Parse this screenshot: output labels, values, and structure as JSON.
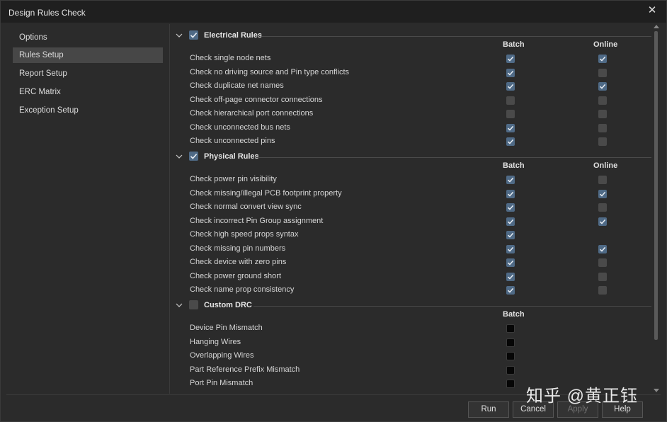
{
  "window": {
    "title": "Design Rules Check"
  },
  "sidebar": {
    "items": [
      {
        "label": "Options"
      },
      {
        "label": "Rules Setup"
      },
      {
        "label": "Report Setup"
      },
      {
        "label": "ERC Matrix"
      },
      {
        "label": "Exception Setup"
      }
    ],
    "active_index": 1
  },
  "sections": [
    {
      "title": "Electrical Rules",
      "enabled": true,
      "headers": {
        "batch": "Batch",
        "online": "Online"
      },
      "rows": [
        {
          "label": "Check single node nets",
          "batch": true,
          "online": true
        },
        {
          "label": "Check no driving source and Pin type conflicts",
          "batch": true,
          "online": false
        },
        {
          "label": "Check duplicate net names",
          "batch": true,
          "online": true
        },
        {
          "label": "Check off-page connector connections",
          "batch": false,
          "online": false
        },
        {
          "label": "Check hierarchical port connections",
          "batch": false,
          "online": false
        },
        {
          "label": "Check unconnected bus nets",
          "batch": true,
          "online": false
        },
        {
          "label": "Check unconnected pins",
          "batch": true,
          "online": false
        }
      ]
    },
    {
      "title": "Physical Rules",
      "enabled": true,
      "headers": {
        "batch": "Batch",
        "online": "Online"
      },
      "rows": [
        {
          "label": "Check power pin visibility",
          "batch": true,
          "online": false
        },
        {
          "label": "Check missing/illegal PCB footprint property",
          "batch": true,
          "online": true
        },
        {
          "label": "Check normal convert view sync",
          "batch": true,
          "online": false
        },
        {
          "label": "Check incorrect Pin Group assignment",
          "batch": true,
          "online": true
        },
        {
          "label": "Check high speed props syntax",
          "batch": true,
          "online": null
        },
        {
          "label": "Check missing pin numbers",
          "batch": true,
          "online": true
        },
        {
          "label": "Check device with zero pins",
          "batch": true,
          "online": false
        },
        {
          "label": "Check power ground short",
          "batch": true,
          "online": false
        },
        {
          "label": "Check name prop consistency",
          "batch": true,
          "online": false
        }
      ]
    },
    {
      "title": "Custom DRC",
      "enabled": false,
      "headers": {
        "batch": "Batch"
      },
      "rows": [
        {
          "label": "Device Pin Mismatch",
          "batch": false
        },
        {
          "label": "Hanging Wires",
          "batch": false
        },
        {
          "label": "Overlapping Wires",
          "batch": false
        },
        {
          "label": "Part Reference Prefix Mismatch",
          "batch": false
        },
        {
          "label": "Port Pin Mismatch",
          "batch": false
        }
      ]
    }
  ],
  "buttons": [
    {
      "label": "Run",
      "enabled": true
    },
    {
      "label": "Cancel",
      "enabled": true
    },
    {
      "label": "Apply",
      "enabled": false
    },
    {
      "label": "Help",
      "enabled": true
    }
  ],
  "watermark": "知乎 @黄正钰",
  "colors": {
    "check_fill": "#4f6a86",
    "unchecked_fill": "#4a4a4a",
    "custom_box": "#060606"
  }
}
